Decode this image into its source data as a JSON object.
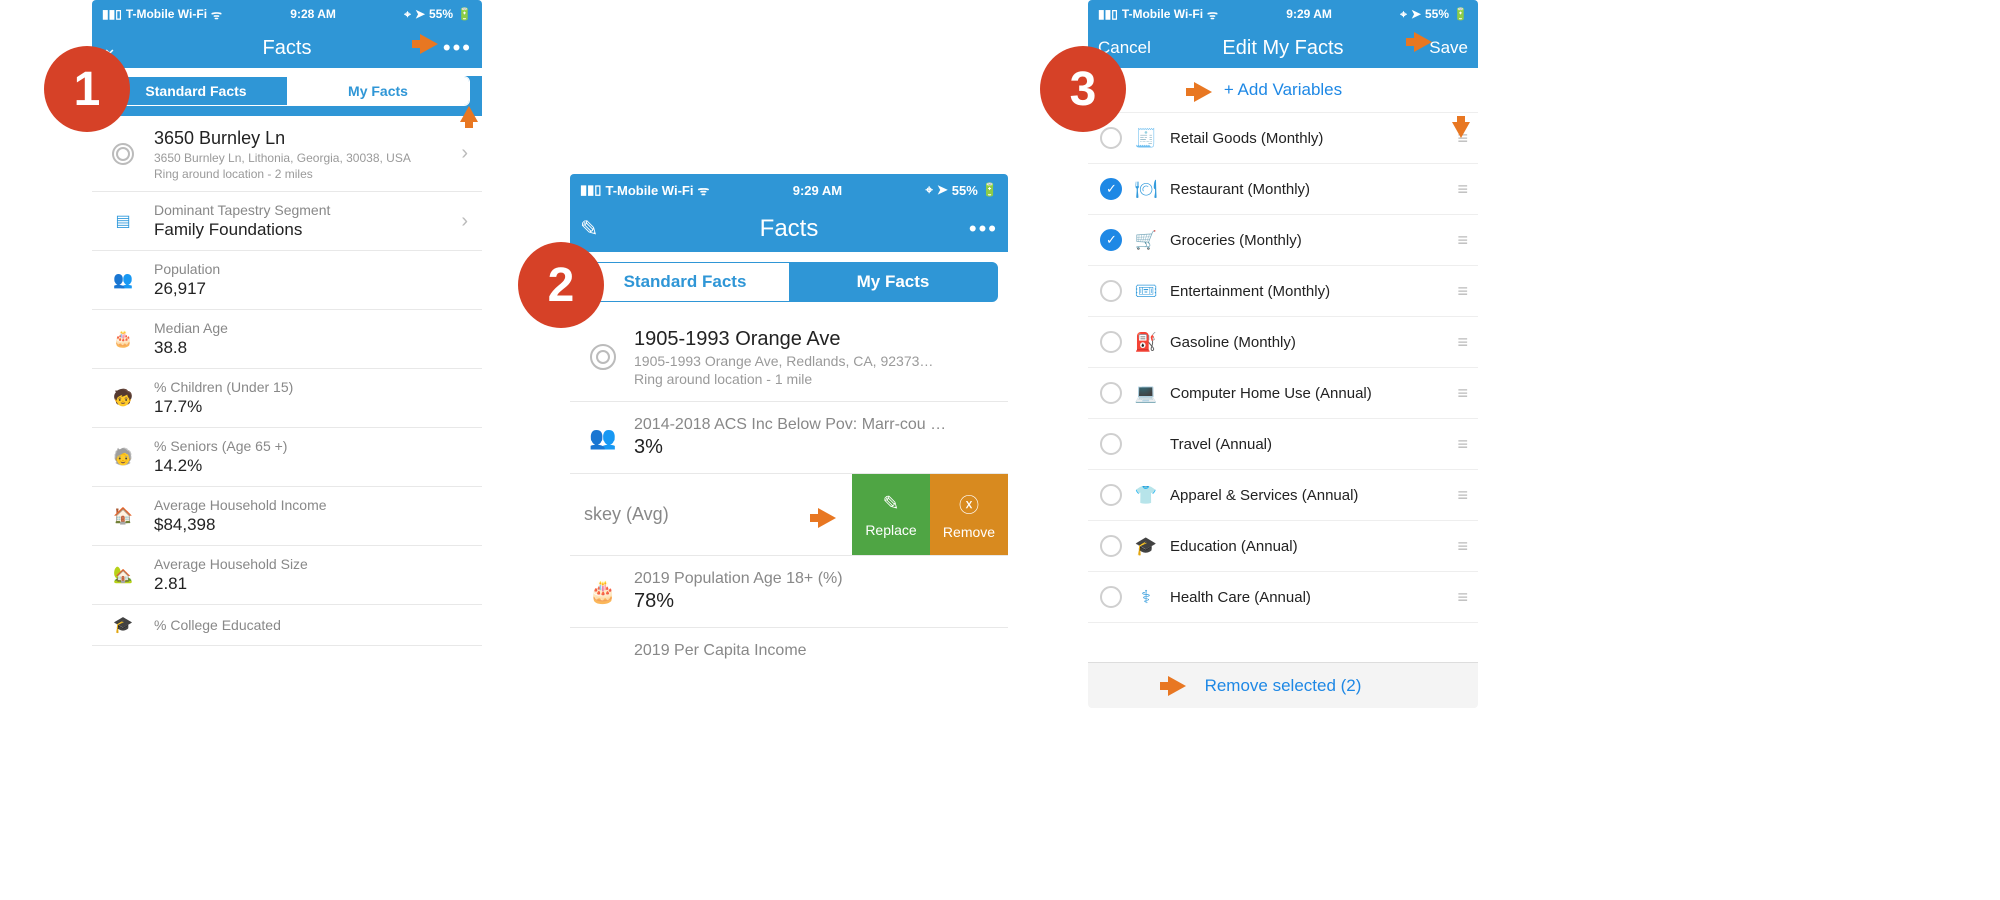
{
  "statusbar": {
    "carrier": "T-Mobile Wi-Fi",
    "time1": "9:28 AM",
    "time2": "9:29 AM",
    "battery": "55%"
  },
  "screen1": {
    "title": "Facts",
    "tabs": {
      "left": "Standard Facts",
      "right": "My Facts"
    },
    "location": {
      "title": "3650 Burnley Ln",
      "address": "3650 Burnley Ln, Lithonia, Georgia, 30038, USA",
      "ring": "Ring around location - 2 miles"
    },
    "tapestry": {
      "label": "Dominant Tapestry Segment",
      "value": "Family Foundations"
    },
    "facts": [
      {
        "icon": "people-icon",
        "label": "Population",
        "value": "26,917"
      },
      {
        "icon": "cake-icon",
        "label": "Median Age",
        "value": "38.8"
      },
      {
        "icon": "child-icon",
        "label": "% Children (Under 15)",
        "value": "17.7%"
      },
      {
        "icon": "senior-icon",
        "label": "% Seniors (Age 65 +)",
        "value": "14.2%"
      },
      {
        "icon": "house-money-icon",
        "label": "Average Household Income",
        "value": "$84,398"
      },
      {
        "icon": "household-icon",
        "label": "Average Household Size",
        "value": "2.81"
      },
      {
        "icon": "grad-icon",
        "label": "% College Educated",
        "value": ""
      }
    ]
  },
  "screen2": {
    "title": "Facts",
    "tabs": {
      "left": "Standard Facts",
      "right": "My Facts"
    },
    "location": {
      "title": "1905-1993 Orange Ave",
      "address": "1905-1993 Orange Ave, Redlands, CA, 92373…",
      "ring": "Ring around location - 1 mile"
    },
    "facts": [
      {
        "label": "2014-2018 ACS Inc Below Pov: Marr-cou …",
        "value": "3%"
      },
      {
        "label": "skey (Avg)",
        "replace": "Replace",
        "remove": "Remove"
      },
      {
        "label": "2019 Population Age 18+ (%)",
        "value": "78%"
      },
      {
        "label": "2019 Per Capita Income",
        "value": ""
      }
    ]
  },
  "screen3": {
    "cancel": "Cancel",
    "title": "Edit My Facts",
    "save": "Save",
    "add": "+ Add Variables",
    "vars": [
      {
        "checked": false,
        "icon": "🧾",
        "name": "Retail Goods (Monthly)"
      },
      {
        "checked": true,
        "icon": "🍽",
        "name": "Restaurant (Monthly)"
      },
      {
        "checked": true,
        "icon": "🛒",
        "name": "Groceries (Monthly)"
      },
      {
        "checked": false,
        "icon": "🎟",
        "name": "Entertainment (Monthly)"
      },
      {
        "checked": false,
        "icon": "⛽",
        "name": "Gasoline (Monthly)"
      },
      {
        "checked": false,
        "icon": "💻",
        "name": "Computer Home Use (Annual)"
      },
      {
        "checked": false,
        "icon": "",
        "name": "Travel (Annual)"
      },
      {
        "checked": false,
        "icon": "👕",
        "name": "Apparel & Services (Annual)"
      },
      {
        "checked": false,
        "icon": "🎓",
        "name": "Education (Annual)"
      },
      {
        "checked": false,
        "icon": "⚕",
        "name": "Health Care (Annual)"
      }
    ],
    "footer": "Remove selected (2)"
  },
  "badges": {
    "b1": "1",
    "b2": "2",
    "b3": "3"
  }
}
